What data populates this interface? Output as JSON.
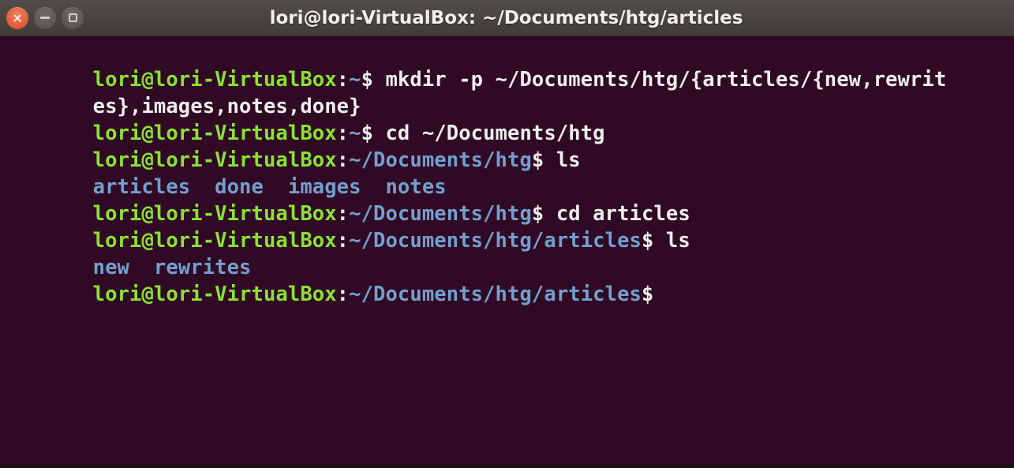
{
  "window": {
    "title": "lori@lori-VirtualBox: ~/Documents/htg/articles",
    "controls": {
      "close_label": "Close",
      "minimize_label": "Minimize",
      "maximize_label": "Maximize"
    }
  },
  "colors": {
    "titlebar": "#48443f",
    "terminal_background": "#300a24",
    "prompt_green": "#8ae234",
    "path_blue": "#729fcf",
    "text_white": "#eeeeec",
    "close_button": "#e8613c"
  },
  "terminal": {
    "user_host": "lori@lori-VirtualBox",
    "lines": [
      {
        "id": "line-1",
        "type": "command",
        "user_host": "lori@lori-VirtualBox",
        "colon": ":",
        "path": "~",
        "dollar": "$",
        "command": " mkdir -p ~/Documents/htg/{articles/{new,rewrit"
      },
      {
        "id": "line-2",
        "type": "wrapped-command",
        "command": "es},images,notes,done}"
      },
      {
        "id": "line-3",
        "type": "command",
        "user_host": "lori@lori-VirtualBox",
        "colon": ":",
        "path": "~",
        "dollar": "$",
        "command": " cd ~/Documents/htg"
      },
      {
        "id": "line-4",
        "type": "command",
        "user_host": "lori@lori-VirtualBox",
        "colon": ":",
        "path": "~/Documents/htg",
        "dollar": "$",
        "command": " ls"
      },
      {
        "id": "line-5",
        "type": "output",
        "output": "articles  done  images  notes"
      },
      {
        "id": "line-6",
        "type": "command",
        "user_host": "lori@lori-VirtualBox",
        "colon": ":",
        "path": "~/Documents/htg",
        "dollar": "$",
        "command": " cd articles"
      },
      {
        "id": "line-7",
        "type": "command",
        "user_host": "lori@lori-VirtualBox",
        "colon": ":",
        "path": "~/Documents/htg/articles",
        "dollar": "$",
        "command": " ls"
      },
      {
        "id": "line-8",
        "type": "output",
        "output": "new  rewrites"
      },
      {
        "id": "line-9",
        "type": "prompt",
        "user_host": "lori@lori-VirtualBox",
        "colon": ":",
        "path": "~/Documents/htg/articles",
        "dollar": "$",
        "command": ""
      }
    ]
  }
}
